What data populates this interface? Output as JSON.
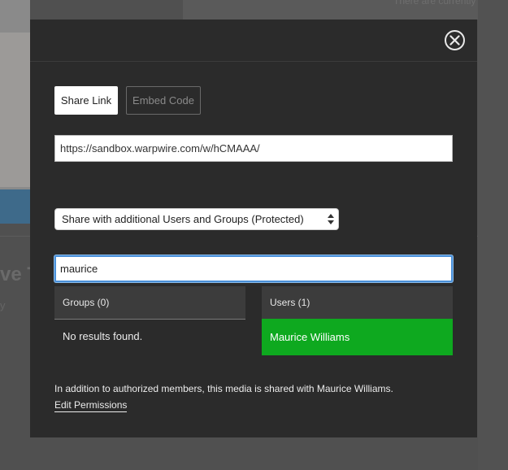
{
  "background": {
    "top_right_text": "There are currently no a",
    "title_fragment": "ve T",
    "sub_fragment": "y"
  },
  "modal": {
    "close_icon": "close-circle-icon",
    "tabs": [
      {
        "label": "Share Link",
        "active": true
      },
      {
        "label": "Embed Code",
        "active": false
      }
    ],
    "share_url": "https://sandbox.warpwire.com/w/hCMAAA/",
    "share_select": {
      "selected": "Share with additional Users and Groups (Protected)"
    },
    "search": {
      "value": "maurice"
    },
    "groups": {
      "header": "Groups (0)",
      "empty_text": "No results found."
    },
    "users": {
      "header": "Users (1)",
      "results": [
        "Maurice Williams"
      ]
    },
    "info_text": "In addition to authorized members, this media is shared with Maurice Williams.",
    "edit_link": "Edit Permissions"
  },
  "colors": {
    "modal_bg": "#2b2b2b",
    "selected_user": "#0ea91f",
    "focus_ring": "#4a90d9"
  }
}
